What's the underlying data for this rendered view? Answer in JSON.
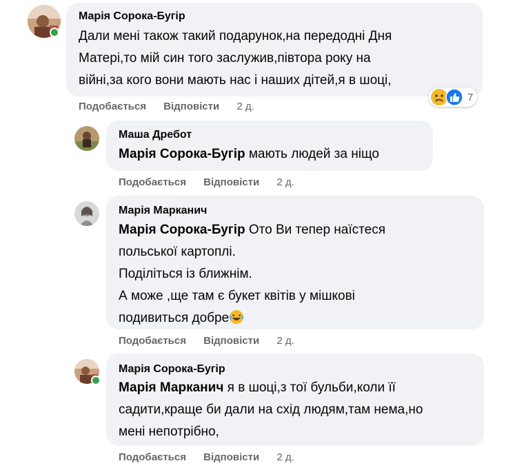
{
  "comments": [
    {
      "author": "Марія Сорока-Бугір",
      "lines": [
        "Дали мені також такий подарунок,на передодні Дня",
        "Матері,то мій син того заслужив,півтора року на",
        "війні,за кого вони мають нас і наших дітей,я в шоці,"
      ],
      "like_label": "Подобається",
      "reply_label": "Відповісти",
      "time": "2 д.",
      "reactions": {
        "icons": [
          "sad-icon",
          "like-icon"
        ],
        "count": "7"
      },
      "online": true
    },
    {
      "author": "Маша Дребот",
      "mention": "Марія Сорока-Бугір",
      "lines": [
        " мають людей за ніщо"
      ],
      "like_label": "Подобається",
      "reply_label": "Відповісти",
      "time": "2 д.",
      "online": false
    },
    {
      "author": "Марія Марканич",
      "mention": "Марія Сорока-Бугір",
      "lines": [
        " Ото Ви тепер наїстеся",
        "польської картоплі.",
        "Поділіться із ближнім.",
        "А може ,ще там є букет квітів у мішкові",
        "подивиться добре"
      ],
      "trailing_emoji": "laughing-tears-icon",
      "like_label": "Подобається",
      "reply_label": "Відповісти",
      "time": "2 д.",
      "online": false
    },
    {
      "author": "Марія Сорока-Бугір",
      "mention": "Марія Марканич",
      "lines": [
        " я в шоці,з тої бульби,коли її",
        "садити,краще би дали на схід людям,там нема,но",
        "мені непотрібно,"
      ],
      "like_label": "Подобається",
      "reply_label": "Відповісти",
      "time": "2 д.",
      "online": true
    }
  ],
  "colors": {
    "bubble": "#f0f2f5",
    "secondary_text": "#65676b",
    "online": "#31a24c",
    "like_blue": "#1877f2",
    "sad_yellow": "#f7b928"
  }
}
